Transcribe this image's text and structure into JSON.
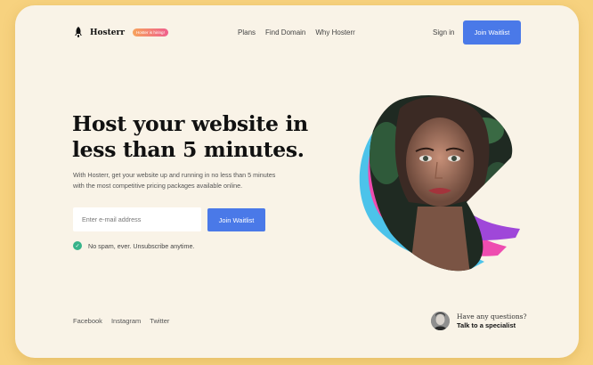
{
  "header": {
    "brand": "Hosterr",
    "badge": "Hoster is hiring!",
    "nav": [
      "Plans",
      "Find Domain",
      "Why Hosterr"
    ],
    "sign_in": "Sign in",
    "cta": "Join Waitlist"
  },
  "hero": {
    "title_line1": "Host your website in",
    "title_line2": "less than 5 minutes.",
    "subtitle": "With Hosterr, get your website up and running in no less than 5 minutes with the most competitive pricing packages available online.",
    "email_placeholder": "Enter e-mail address",
    "join_button": "Join Waitlist",
    "note": "No spam, ever. Unsubscribe anytime."
  },
  "footer": {
    "social": [
      "Facebook",
      "Instagram",
      "Twitter"
    ],
    "question": "Have any questions?",
    "contact_link": "Talk to a specialist"
  },
  "colors": {
    "page_bg": "#f7d27f",
    "card_bg": "#f9f3e7",
    "accent": "#4a79e8",
    "check_green": "#37b38a"
  },
  "icons": [
    "rocket-icon",
    "check-icon"
  ]
}
